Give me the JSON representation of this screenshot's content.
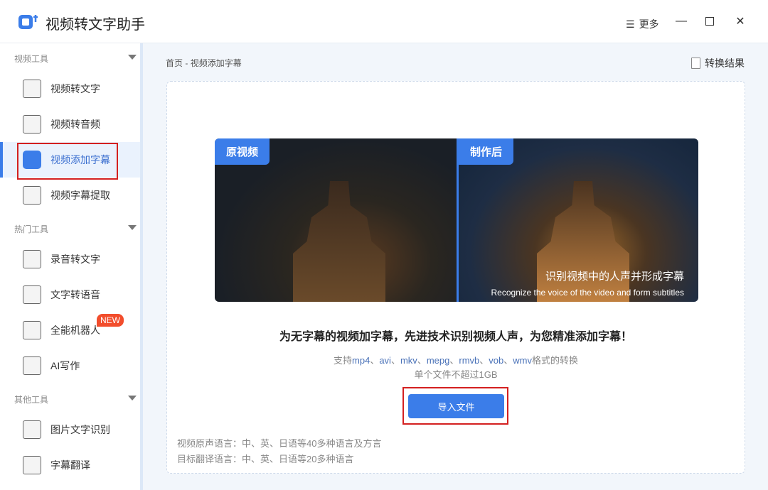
{
  "app": {
    "title": "视频转文字助手",
    "more": "更多"
  },
  "sidebar": {
    "sections": [
      {
        "label": "视频工具",
        "items": [
          "视频转文字",
          "视频转音频",
          "视频添加字幕",
          "视频字幕提取"
        ]
      },
      {
        "label": "热门工具",
        "items": [
          "录音转文字",
          "文字转语音",
          "全能机器人",
          "AI写作"
        ]
      },
      {
        "label": "其他工具",
        "items": [
          "图片文字识别",
          "字幕翻译"
        ]
      }
    ],
    "new_badge": "NEW"
  },
  "main": {
    "breadcrumb": {
      "home": "首页",
      "sep": "-",
      "current": "视频添加字幕"
    },
    "result_button": "转换结果",
    "preview": {
      "before": "原视频",
      "after": "制作后",
      "subtitle_cn": "识别视频中的人声并形成字幕",
      "subtitle_en": "Recognize the voice of the video and form subtitles"
    },
    "headline": "为无字幕的视频加字幕，先进技术识别视频人声，为您精准添加字幕！",
    "formats": {
      "prefix": "支持",
      "list": [
        "mp4",
        "avi",
        "mkv",
        "mepg",
        "rmvb",
        "vob",
        "wmv"
      ],
      "suffix": "格式的转换",
      "f0": "mp4",
      "f1": "avi",
      "f2": "mkv",
      "f3": "mepg",
      "f4": "rmvb",
      "f5": "vob",
      "f6": "wmv",
      "sep": "、"
    },
    "size_limit": "单个文件不超过1GB",
    "import_button": "导入文件",
    "source_lang": "视频原声语言：中、英、日语等40多种语言及方言",
    "target_lang": "目标翻译语言：中、英、日语等20多种语言"
  },
  "colors": {
    "accent": "#3b7de9",
    "highlight": "#d42020",
    "badge": "#f24d2c"
  }
}
